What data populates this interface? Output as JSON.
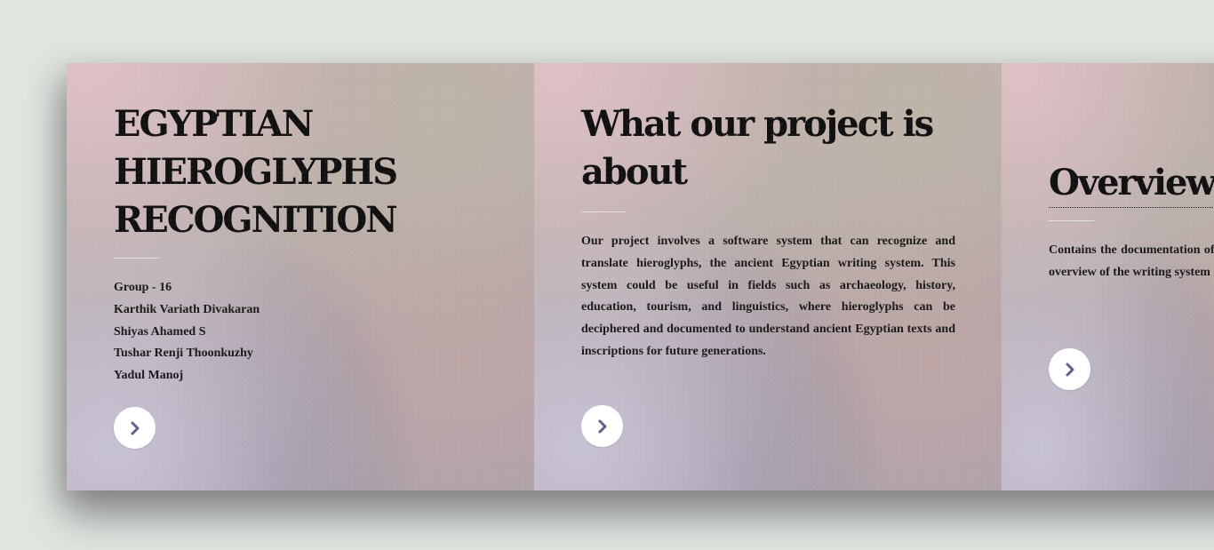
{
  "accent_color": "#6b5a8a",
  "panels": [
    {
      "title": "EGYPTIAN HIEROGLYPHS RECOGNITION",
      "members": [
        "Group - 16",
        "Karthik Variath Divakaran",
        "Shiyas Ahamed S",
        "Tushar Renji Thoonkuzhy",
        "Yadul Manoj"
      ],
      "next_icon": "chevron-right-icon"
    },
    {
      "title": "What our project is about",
      "body": "Our project involves a software system that can recognize and translate hieroglyphs, the ancient Egyptian writing system. This system could be useful in fields such as archaeology, history, education, tourism, and linguistics, where hieroglyphs can be deciphered and documented to understand ancient Egyptian texts and inscriptions for future generations.",
      "next_icon": "chevron-right-icon"
    },
    {
      "title": "Overview",
      "body": "Contains the documentation of Egyptian hieroglyphs and provides an overview of the writing system representing the language",
      "next_icon": "chevron-right-icon"
    }
  ]
}
